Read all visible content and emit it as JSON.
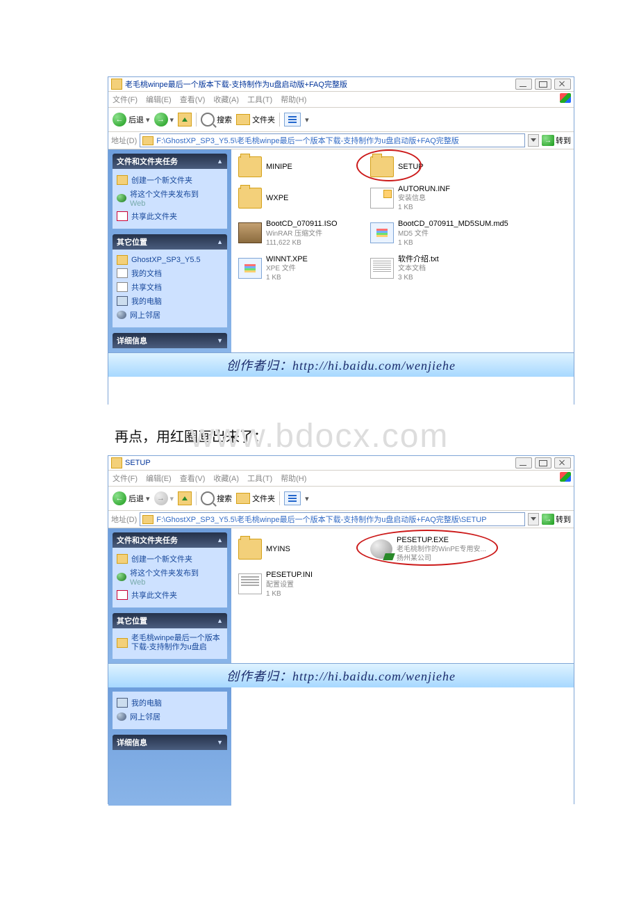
{
  "watermark": "www.bdocx.com",
  "interlude_text": "再点，用红圈画出来了：",
  "credit_banner": "创作者归：http://hi.baidu.com/wenjiehe",
  "menu": {
    "file": "文件(F)",
    "edit": "编辑(E)",
    "view": "查看(V)",
    "fav": "收藏(A)",
    "tools": "工具(T)",
    "help": "帮助(H)"
  },
  "toolbar": {
    "back": "后退",
    "search": "搜索",
    "folders": "文件夹"
  },
  "address": {
    "label": "地址(D)",
    "go": "转到"
  },
  "sidebar_headers": {
    "tasks": "文件和文件夹任务",
    "other": "其它位置",
    "details": "详细信息"
  },
  "sidebar_tasks": {
    "new_folder": "创建一个新文件夹",
    "publish": "将这个文件夹发布到",
    "publish_sub": "Web",
    "share": "共享此文件夹"
  },
  "win1": {
    "title": "老毛桃winpe最后一个版本下载-支持制作为u盘启动版+FAQ完整版",
    "path": "F:\\GhostXP_SP3_Y5.5\\老毛桃winpe最后一个版本下载-支持制作为u盘启动版+FAQ完整版",
    "other_places": {
      "p0": "GhostXP_SP3_Y5.5",
      "p1": "我的文档",
      "p2": "共享文档",
      "p3": "我的电脑",
      "p4": "网上邻居"
    },
    "files": {
      "f0": {
        "name": "MINIPE"
      },
      "f1": {
        "name": "SETUP"
      },
      "f2": {
        "name": "WXPE"
      },
      "f3": {
        "name": "AUTORUN.INF",
        "sub1": "安装信息",
        "sub2": "1 KB"
      },
      "f4": {
        "name": "BootCD_070911.ISO",
        "sub1": "WinRAR 压缩文件",
        "sub2": "111,622 KB"
      },
      "f5": {
        "name": "BootCD_070911_MD5SUM.md5",
        "sub1": "MD5 文件",
        "sub2": "1 KB"
      },
      "f6": {
        "name": "WINNT.XPE",
        "sub1": "XPE 文件",
        "sub2": "1 KB"
      },
      "f7": {
        "name": "软件介绍.txt",
        "sub1": "文本文档",
        "sub2": "3 KB"
      }
    }
  },
  "win2": {
    "title": "SETUP",
    "path": "F:\\GhostXP_SP3_Y5.5\\老毛桃winpe最后一个版本下载-支持制作为u盘启动版+FAQ完整版\\SETUP",
    "other_places": {
      "p0": "老毛桃winpe最后一个版本下载-支持制作为u盘启",
      "p1": "我的电脑",
      "p2": "网上邻居"
    },
    "files": {
      "f0": {
        "name": "MYINS"
      },
      "f1": {
        "name": "PESETUP.EXE",
        "sub1": "老毛桃制作的WinPE专用安...",
        "sub2": "扬州某公司"
      },
      "f2": {
        "name": "PESETUP.INI",
        "sub1": "配置设置",
        "sub2": "1 KB"
      }
    }
  }
}
